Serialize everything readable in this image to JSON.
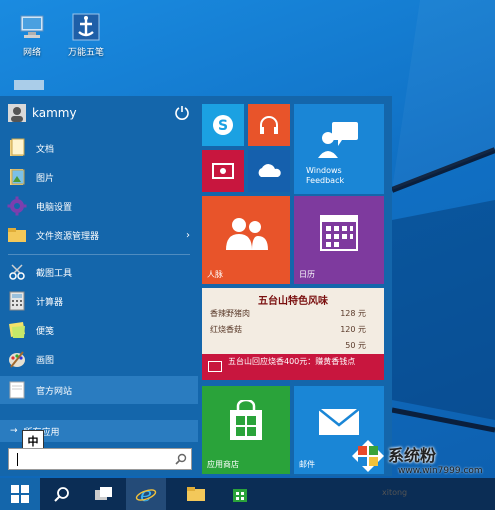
{
  "desktop": {
    "icons": [
      {
        "label": "网络"
      },
      {
        "label": "万能五笔"
      }
    ]
  },
  "start_menu": {
    "user": {
      "name": "kammy"
    },
    "items": [
      {
        "label": "文档",
        "icon": "documents-icon"
      },
      {
        "label": "图片",
        "icon": "pictures-icon"
      },
      {
        "label": "电脑设置",
        "icon": "gear-icon"
      },
      {
        "label": "文件资源管理器",
        "icon": "folder-icon",
        "chevron": "›"
      },
      {
        "label": "截图工具",
        "icon": "snipping-tool-icon"
      },
      {
        "label": "计算器",
        "icon": "calculator-icon"
      },
      {
        "label": "便笺",
        "icon": "sticky-note-icon"
      },
      {
        "label": "画图",
        "icon": "paint-icon"
      },
      {
        "label": "官方网站",
        "icon": "web-page-icon"
      }
    ],
    "all_apps": {
      "label": "所有应用",
      "arrow": "→"
    },
    "ime_indicator": "中",
    "search": {
      "value": "",
      "placeholder": ""
    }
  },
  "tiles": {
    "skype": {
      "icon": "skype-icon"
    },
    "music": {
      "icon": "headphones-icon"
    },
    "feedback": {
      "label_line1": "Windows",
      "label_line2": "Feedback"
    },
    "video": {
      "icon": "video-icon"
    },
    "onedrive": {
      "icon": "cloud-icon"
    },
    "people": {
      "label": "人脉"
    },
    "calendar": {
      "label": "日历"
    },
    "news": {
      "header": "五台山特色风味",
      "rows": [
        {
          "name": "香辣野猪肉",
          "price": "128 元"
        },
        {
          "name": "红烧香菇",
          "price": "120 元"
        },
        {
          "name": "",
          "price": "50 元"
        }
      ],
      "headline": "五台山回应烧香400元：赚黄香钱点"
    },
    "store": {
      "label": "应用商店"
    },
    "mail": {
      "label": "邮件"
    }
  },
  "watermark": {
    "text": "系统粉",
    "url": "www.win7999.com",
    "prefix": "xitong"
  },
  "colors": {
    "start_bg": "#1466ab",
    "skype": "#1ba1e2",
    "music": "#e8542a",
    "feedback": "#1a86d6",
    "video": "#c8163e",
    "onedrive": "#1560ad",
    "people": "#e8542a",
    "calendar": "#7e3a9e",
    "store": "#2aa33a",
    "mail": "#1a86d6",
    "taskbar": "#0b2d55"
  }
}
